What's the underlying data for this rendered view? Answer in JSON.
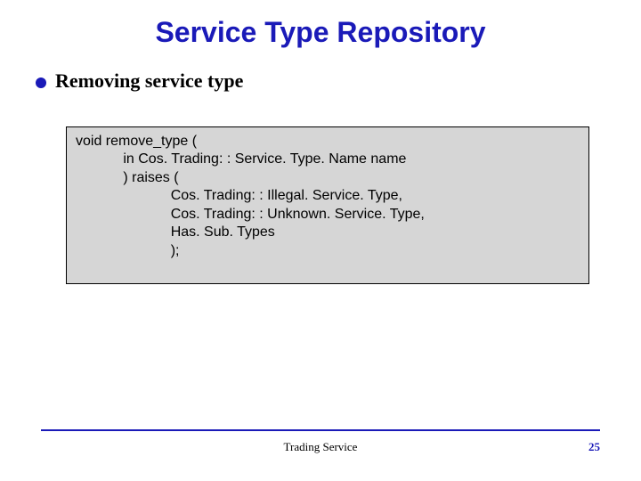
{
  "title": "Service Type Repository",
  "bullet": "Removing service type",
  "code": "void remove_type (\n            in Cos. Trading: : Service. Type. Name name\n            ) raises (\n                        Cos. Trading: : Illegal. Service. Type,\n                        Cos. Trading: : Unknown. Service. Type,\n                        Has. Sub. Types\n                        );",
  "footer": {
    "center": "Trading Service",
    "page": "25"
  }
}
